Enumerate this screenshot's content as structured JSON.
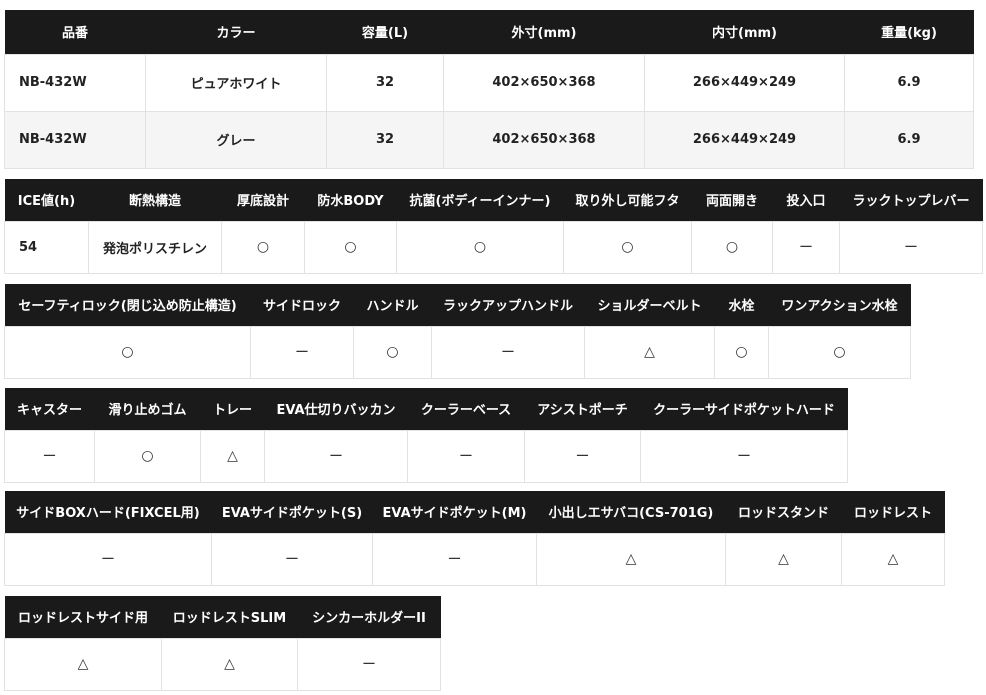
{
  "table1": {
    "headers": [
      "品番",
      "カラー",
      "容量(L)",
      "外寸(mm)",
      "内寸(mm)",
      "重量(kg)"
    ],
    "rows": [
      [
        "NB-432W",
        "ピュアホワイト",
        "32",
        "402×650×368",
        "266×449×249",
        "6.9"
      ],
      [
        "NB-432W",
        "グレー",
        "32",
        "402×650×368",
        "266×449×249",
        "6.9"
      ]
    ]
  },
  "table2": {
    "headers": [
      "ICE値(h)",
      "断熱構造",
      "厚底設計",
      "防水BODY",
      "抗菌(ボディーインナー)",
      "取り外し可能フタ",
      "両面開き",
      "投入口",
      "ラックトップレバー"
    ],
    "values": [
      "54",
      "発泡ポリスチレン",
      "○",
      "○",
      "○",
      "○",
      "○",
      "ー",
      "ー"
    ]
  },
  "table3": {
    "headers": [
      "セーフティロック(閉じ込め防止構造)",
      "サイドロック",
      "ハンドル",
      "ラックアップハンドル",
      "ショルダーベルト",
      "水栓",
      "ワンアクション水栓"
    ],
    "values": [
      "○",
      "ー",
      "○",
      "ー",
      "△",
      "○",
      "○"
    ]
  },
  "table4": {
    "headers": [
      "キャスター",
      "滑り止めゴム",
      "トレー",
      "EVA仕切りバッカン",
      "クーラーベース",
      "アシストポーチ",
      "クーラーサイドポケットハード"
    ],
    "values": [
      "ー",
      "○",
      "△",
      "ー",
      "ー",
      "ー",
      "ー"
    ]
  },
  "table5": {
    "headers": [
      "サイドBOXハード(FIXCEL用)",
      "EVAサイドポケット(S)",
      "EVAサイドポケット(M)",
      "小出しエサバコ(CS-701G)",
      "ロッドスタンド",
      "ロッドレスト"
    ],
    "values": [
      "ー",
      "ー",
      "ー",
      "△",
      "△",
      "△"
    ]
  },
  "table6": {
    "headers": [
      "ロッドレストサイド用",
      "ロッドレストSLIM",
      "シンカーホルダーII"
    ],
    "values": [
      "△",
      "△",
      "ー"
    ]
  }
}
